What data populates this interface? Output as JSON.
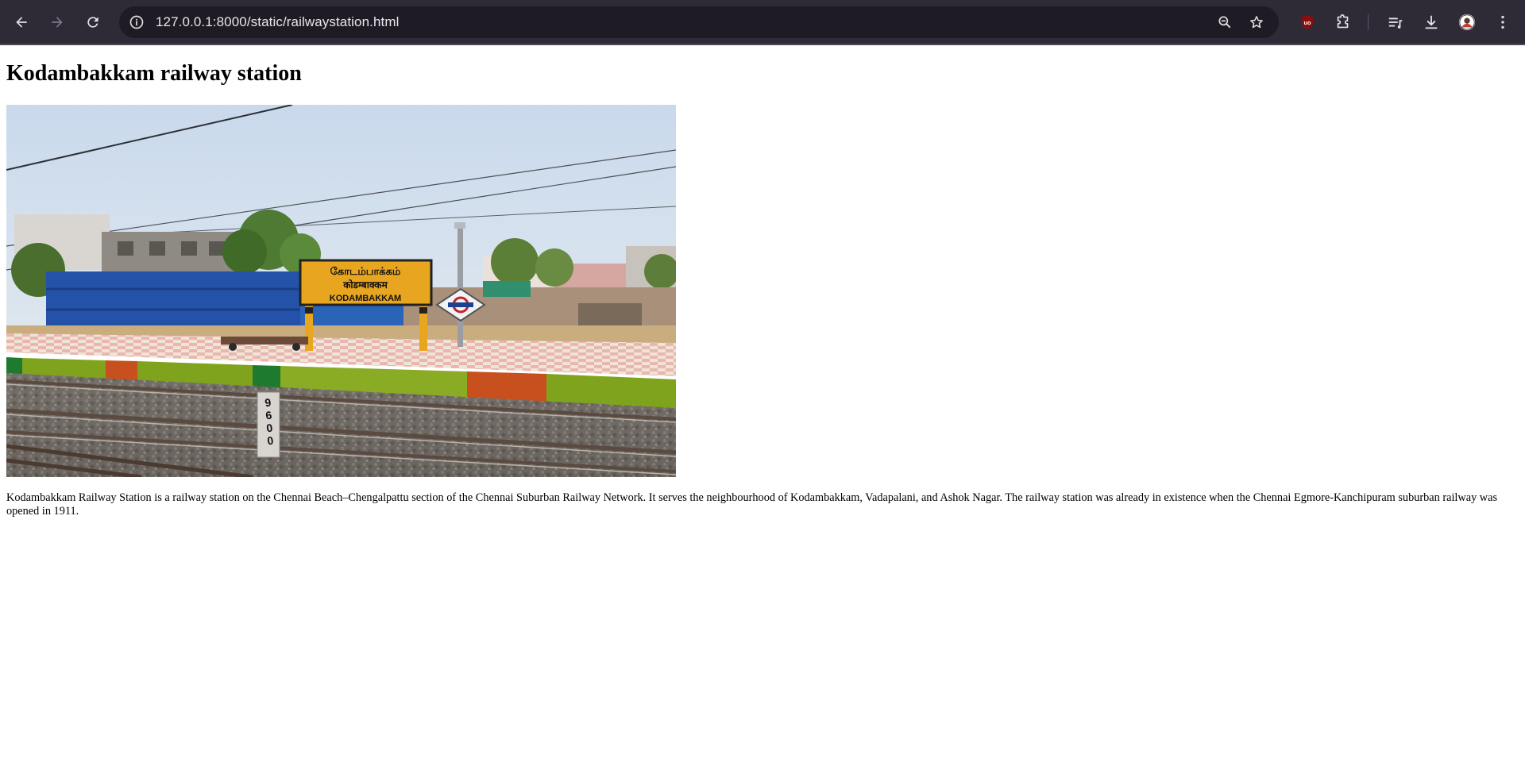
{
  "browser": {
    "url": "127.0.0.1:8000/static/railwaystation.html",
    "icons": [
      "back-arrow-icon",
      "forward-arrow-icon",
      "reload-icon",
      "site-info-icon",
      "zoom-out-icon",
      "bookmark-star-icon",
      "ublock-extension-icon",
      "extensions-puzzle-icon",
      "reading-list-icon",
      "download-icon",
      "profile-avatar-icon",
      "more-menu-icon"
    ]
  },
  "page": {
    "title": "Kodambakkam railway station",
    "image": {
      "sign_line1": "கோடம்பாக்கம்",
      "sign_line2": "कोडम्बाक्कम",
      "sign_line3": "KODAMBAKKAM",
      "marker_line1": "9",
      "marker_line2": "6",
      "marker_line3": "0",
      "marker_line4": "0"
    },
    "description": "Kodambakkam Railway Station is a railway station on the Chennai Beach–Chengalpattu section of the Chennai Suburban Railway Network. It serves the neighbourhood of Kodambakkam, Vadapalani, and Ashok Nagar. The railway station was already in existence when the Chennai Egmore-Kanchipuram suburban railway was opened in 1911."
  },
  "colors": {
    "toolbar": "#2e2b36",
    "omnibox": "#1e1b24",
    "sky": "#cfdcea",
    "sign_yellow": "#e8a520",
    "platform_green": "#7fa31c",
    "platform_orange": "#c8501e"
  }
}
